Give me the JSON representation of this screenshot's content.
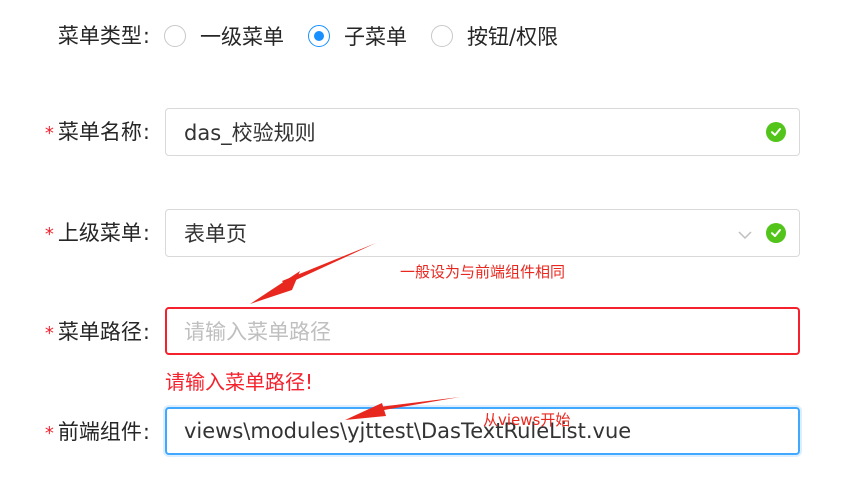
{
  "menu_type": {
    "label": "菜单类型",
    "colon": ":",
    "options": [
      {
        "label": "一级菜单",
        "checked": false
      },
      {
        "label": "子菜单",
        "checked": true
      },
      {
        "label": "按钮/权限",
        "checked": false
      }
    ]
  },
  "menu_name": {
    "required_mark": "*",
    "label": "菜单名称",
    "colon": ":",
    "value": "das_校验规则",
    "status_icon": "check-circle-icon"
  },
  "parent_menu": {
    "required_mark": "*",
    "label": "上级菜单",
    "colon": ":",
    "value": "表单页",
    "dropdown_icon": "chevron-down-icon",
    "status_icon": "check-circle-icon"
  },
  "menu_path": {
    "required_mark": "*",
    "label": "菜单路径",
    "colon": ":",
    "placeholder": "请输入菜单路径",
    "error": "请输入菜单路径!"
  },
  "component": {
    "required_mark": "*",
    "label": "前端组件",
    "colon": ":",
    "value": "views\\modules\\yjttest\\DasTextRuleList.vue"
  },
  "annotations": {
    "path_note": "一般设为与前端组件相同",
    "component_note": "从views开始"
  },
  "colors": {
    "primary": "#1890ff",
    "error": "#f5222d",
    "success": "#52c41a",
    "annotation": "#e8281f"
  }
}
